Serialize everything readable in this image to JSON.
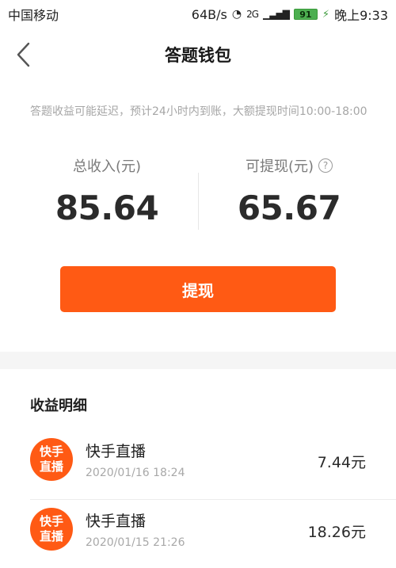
{
  "status_bar": {
    "carrier": "中国移动",
    "speed": "64B/s",
    "network": "2G",
    "battery": "91",
    "time": "晚上9:33"
  },
  "header": {
    "title": "答题钱包"
  },
  "notice": {
    "text": "答题收益可能延迟，预计24小时内到账，大额提现时间10:00-18:00"
  },
  "stats": {
    "total_label": "总收入(元)",
    "total_value": "85.64",
    "withdrawable_label": "可提现(元)",
    "withdrawable_value": "65.67"
  },
  "actions": {
    "withdraw_label": "提现"
  },
  "details": {
    "title": "收益明细",
    "records": [
      {
        "badge_line1": "快手",
        "badge_line2": "直播",
        "name": "快手直播",
        "time": "2020/01/16 18:24",
        "amount": "7.44元"
      },
      {
        "badge_line1": "快手",
        "badge_line2": "直播",
        "name": "快手直播",
        "time": "2020/01/15 21:26",
        "amount": "18.26元"
      }
    ]
  },
  "colors": {
    "accent": "#ff5a14",
    "muted_text": "#a6a6a6",
    "divider": "#ececec"
  },
  "icons": {
    "back": "chevron-left-icon",
    "help": "question-circle-icon",
    "wifi": "wifi-icon",
    "signal": "signal-icon",
    "battery": "battery-icon",
    "charging": "charging-icon"
  }
}
